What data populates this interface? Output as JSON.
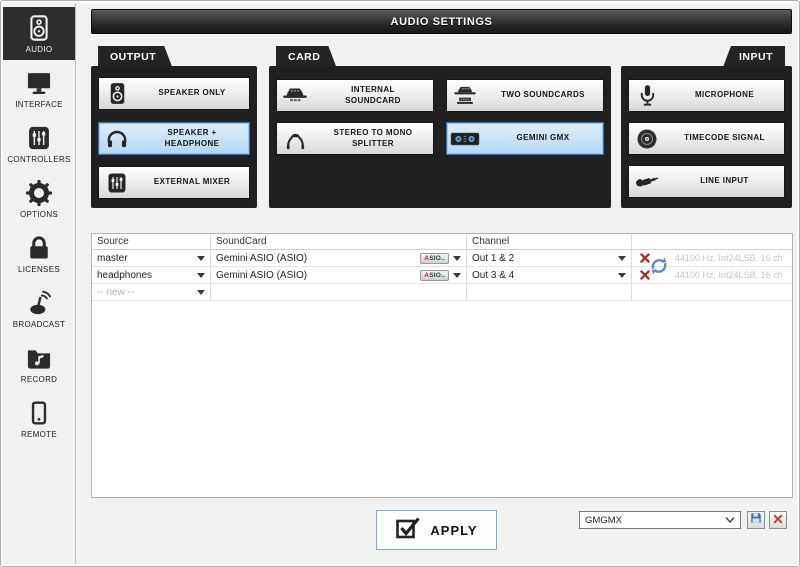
{
  "window": {
    "title": "AUDIO SETTINGS"
  },
  "sidebar": {
    "items": [
      {
        "label": "AUDIO",
        "selected": true
      },
      {
        "label": "INTERFACE",
        "selected": false
      },
      {
        "label": "CONTROLLERS",
        "selected": false
      },
      {
        "label": "OPTIONS",
        "selected": false
      },
      {
        "label": "LICENSES",
        "selected": false
      },
      {
        "label": "BROADCAST",
        "selected": false
      },
      {
        "label": "RECORD",
        "selected": false
      },
      {
        "label": "REMOTE",
        "selected": false
      }
    ]
  },
  "sections": {
    "output": {
      "label": "OUTPUT",
      "buttons": [
        {
          "label": "SPEAKER ONLY",
          "selected": false
        },
        {
          "label": "SPEAKER + HEADPHONE",
          "selected": true
        },
        {
          "label": "EXTERNAL MIXER",
          "selected": false
        }
      ]
    },
    "card": {
      "label": "CARD",
      "buttons": [
        {
          "label": "INTERNAL SOUNDCARD",
          "selected": false
        },
        {
          "label": "TWO SOUNDCARDS",
          "selected": false
        },
        {
          "label": "STEREO TO MONO SPLITTER",
          "selected": false
        },
        {
          "label": "GEMINI GMX",
          "selected": true
        }
      ]
    },
    "input": {
      "label": "INPUT",
      "buttons": [
        {
          "label": "MICROPHONE",
          "selected": false
        },
        {
          "label": "TIMECODE SIGNAL",
          "selected": false
        },
        {
          "label": "LINE INPUT",
          "selected": false
        }
      ]
    }
  },
  "table": {
    "columns": [
      "Source",
      "SoundCard",
      "Channel"
    ],
    "rows": [
      {
        "source": "master",
        "soundcard": "Gemini ASIO (ASIO)",
        "asio_button": "ASIO..",
        "channel": "Out 1 & 2",
        "status": "44100 Hz, Int24LSB, 16 ch"
      },
      {
        "source": "headphones",
        "soundcard": "Gemini ASIO (ASIO)",
        "asio_button": "ASIO..",
        "channel": "Out 3 & 4",
        "status": "44100 Hz, Int24LSB, 16 ch"
      }
    ],
    "new_row_label": "-- new --"
  },
  "footer": {
    "apply_label": "APPLY",
    "preset_value": "GMGMX"
  },
  "colors": {
    "selected_button_bg": "#c4e0f7",
    "selected_button_border": "#3c7ab5",
    "panel_dark": "#202020",
    "error_red": "#a93226",
    "refresh_blue": "#5b87c5",
    "status_text_gray": "#c6c6c6",
    "apply_border_blue": "#76ace0"
  }
}
